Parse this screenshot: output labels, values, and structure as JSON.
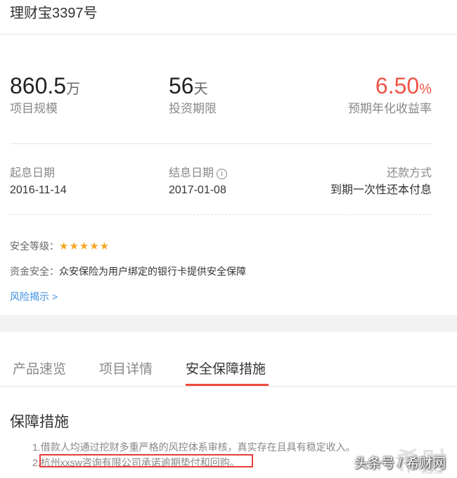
{
  "header": {
    "title": "理财宝3397号"
  },
  "stats": [
    {
      "value": "860.5",
      "unit": "万",
      "label": "项目规模"
    },
    {
      "value": "56",
      "unit": "天",
      "label": "投资期限"
    },
    {
      "value": "6.50",
      "unit": "%",
      "label": "预期年化收益率"
    }
  ],
  "info": {
    "start_label": "起息日期",
    "start_value": "2016-11-14",
    "end_label": "结息日期",
    "end_value": "2017-01-08",
    "repay_label": "还款方式",
    "repay_value": "到期一次性还本付息"
  },
  "safety": {
    "level_label": "安全等级：",
    "stars": "★★★★★",
    "rating": 5,
    "fund_label": "资金安全：",
    "fund_text": "众安保险为用户绑定的银行卡提供安全保障",
    "risk_link": "风险揭示 >"
  },
  "tabs": [
    {
      "label": "产品速览"
    },
    {
      "label": "项目详情"
    },
    {
      "label": "安全保障措施"
    }
  ],
  "section": {
    "title": "保障措施",
    "items": [
      "1.借款人均通过挖财多重严格的风控体系审核，真实存在且具有稳定收入。",
      "2.杭州xxsw咨询有限公司承诺逾期垫付和回购。"
    ]
  },
  "watermark": {
    "logo": "希财",
    "text": "头条号 / 希财网",
    "site": "csai.cn"
  },
  "colors": {
    "accent": "#ee4b3e",
    "rate": "#f05545",
    "link": "#3b8ee0",
    "star": "#f5a623"
  }
}
